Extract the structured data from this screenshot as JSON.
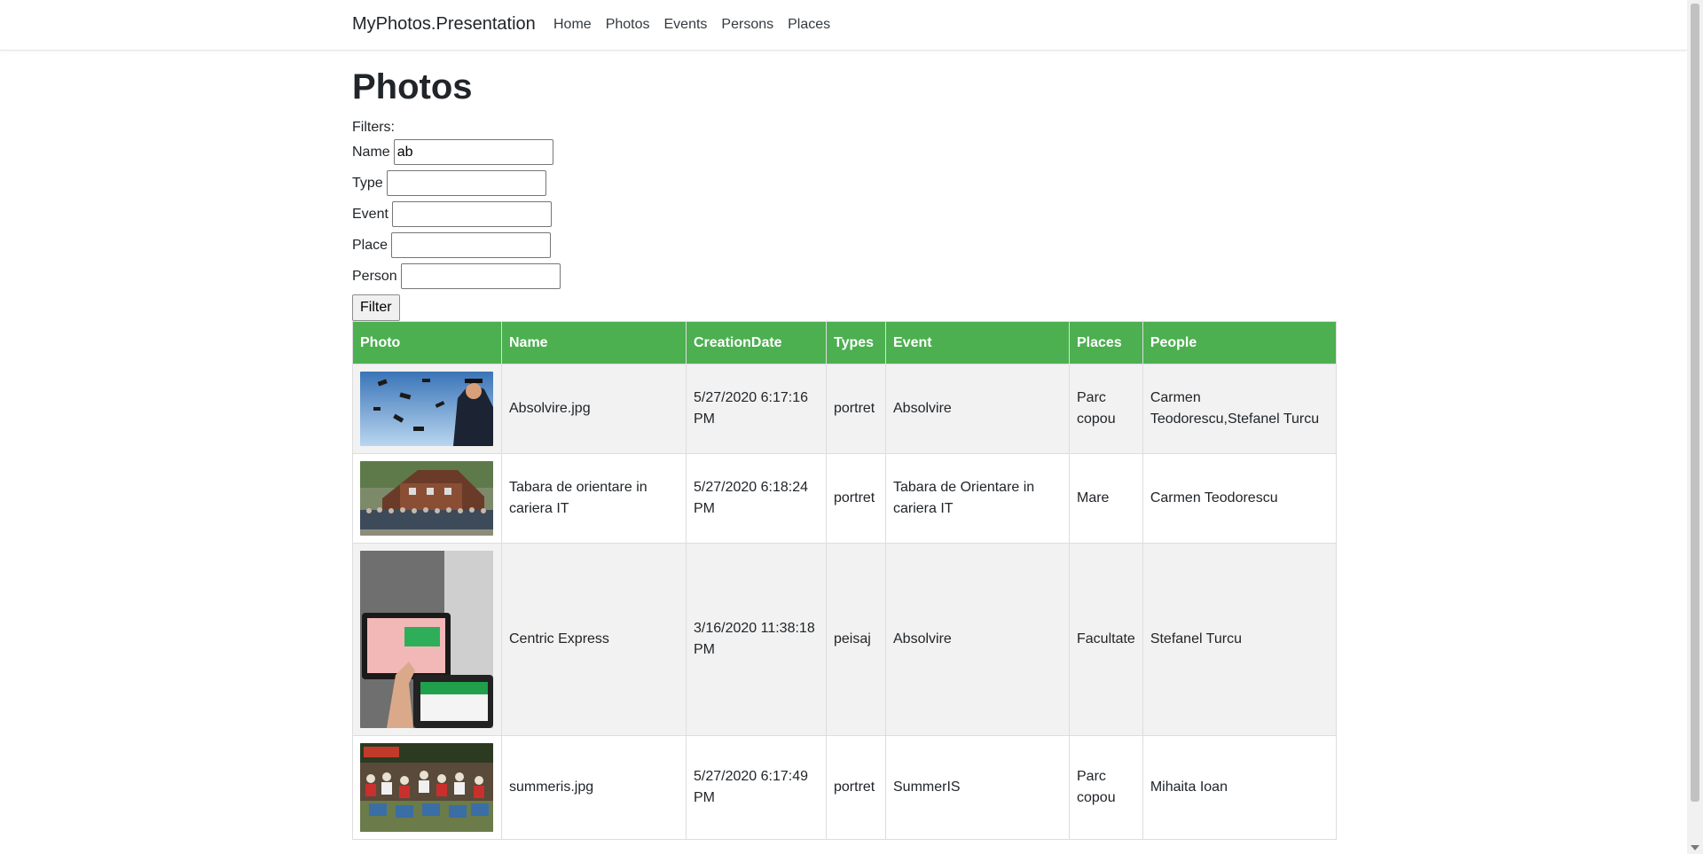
{
  "nav": {
    "brand": "MyPhotos.Presentation",
    "links": [
      "Home",
      "Photos",
      "Events",
      "Persons",
      "Places"
    ]
  },
  "page": {
    "title": "Photos"
  },
  "filters": {
    "label": "Filters:",
    "fields": [
      {
        "label": "Name",
        "value": "ab"
      },
      {
        "label": "Type",
        "value": ""
      },
      {
        "label": "Event",
        "value": ""
      },
      {
        "label": "Place",
        "value": ""
      },
      {
        "label": "Person",
        "value": ""
      }
    ],
    "button": "Filter"
  },
  "table": {
    "headers": [
      "Photo",
      "Name",
      "CreationDate",
      "Types",
      "Event",
      "Places",
      "People"
    ],
    "rows": [
      {
        "name": "Absolvire.jpg",
        "date": "5/27/2020 6:17:16 PM",
        "type": "portret",
        "event": "Absolvire",
        "place": "Parc copou",
        "people": "Carmen Teodorescu,Stefanel Turcu"
      },
      {
        "name": "Tabara de orientare in cariera IT",
        "date": "5/27/2020 6:18:24 PM",
        "type": "portret",
        "event": "Tabara de Orientare in cariera IT",
        "place": "Mare",
        "people": "Carmen Teodorescu"
      },
      {
        "name": "Centric Express",
        "date": "3/16/2020 11:38:18 PM",
        "type": "peisaj",
        "event": "Absolvire",
        "place": "Facultate",
        "people": "Stefanel Turcu"
      },
      {
        "name": "summeris.jpg",
        "date": "5/27/2020 6:17:49 PM",
        "type": "portret",
        "event": "SummerIS",
        "place": "Parc copou",
        "people": "Mihaita Ioan"
      }
    ]
  },
  "colors": {
    "header_bg": "#4caf50",
    "row_alt": "#f2f2f2"
  },
  "icons": {
    "photo_thumbnails": [
      "graduation-caps-photo",
      "group-photo",
      "tablet-thumbs-up-photo",
      "summer-camp-group-photo"
    ]
  }
}
